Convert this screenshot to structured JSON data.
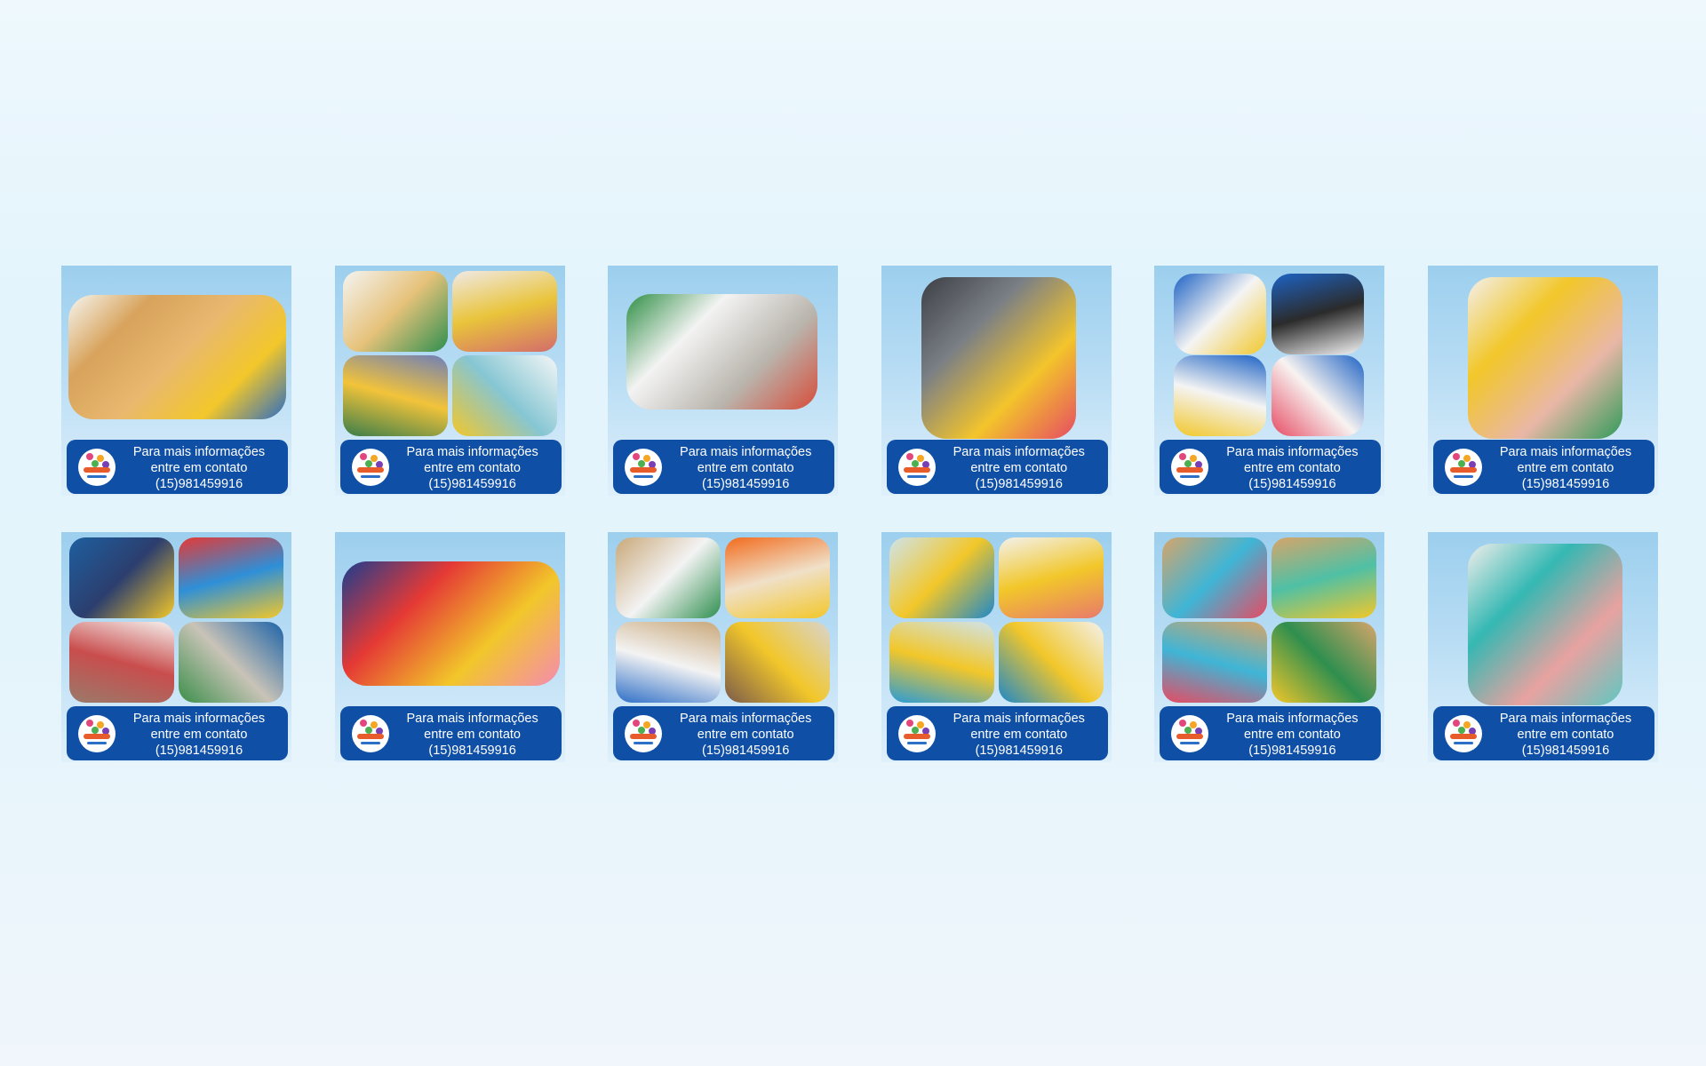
{
  "gallery": {
    "cards": [
      {
        "layout": "single-wide",
        "photo_icons": [
          "photo-icon"
        ],
        "banner": {
          "line1": "Para mais informações",
          "line2": "entre em contato",
          "phone": "(15)981459916"
        },
        "palette": [
          [
            "#f6f6f0",
            "#d8a35c",
            "#e9b86f",
            "#f2c72a",
            "#2d6cc2"
          ]
        ]
      },
      {
        "layout": "quad",
        "photo_icons": [
          "photo-icon",
          "photo-icon",
          "photo-icon",
          "photo-icon"
        ],
        "banner": {
          "line1": "Para mais informações",
          "line2": "entre em contato",
          "phone": "(15)981459916"
        },
        "palette": [
          [
            "#f4f4f2",
            "#e6c27a",
            "#2f8f4f"
          ],
          [
            "#f0e9e6",
            "#e9c43b",
            "#d46c6c"
          ],
          [
            "#6f7fb8",
            "#f2c33a",
            "#3a7d4a"
          ],
          [
            "#f4f6f7",
            "#86c6d3",
            "#f2c72a"
          ]
        ]
      },
      {
        "layout": "single-wide-short",
        "photo_icons": [
          "photo-icon"
        ],
        "banner": {
          "line1": "Para mais informações",
          "line2": "entre em contato",
          "phone": "(15)981459916"
        },
        "palette": [
          [
            "#2f8f45",
            "#f3f3f3",
            "#b9b5ad",
            "#d64d3a"
          ]
        ]
      },
      {
        "layout": "single-tall",
        "photo_icons": [
          "photo-icon"
        ],
        "banner": {
          "line1": "Para mais informações",
          "line2": "entre em contato",
          "phone": "(15)981459916"
        },
        "palette": [
          [
            "#3d3f45",
            "#7a7f86",
            "#f3c42b",
            "#e64b63"
          ]
        ]
      },
      {
        "layout": "quad-circles",
        "photo_icons": [
          "photo-icon",
          "photo-icon",
          "photo-icon",
          "photo-icon"
        ],
        "banner": {
          "line1": "Para mais informações",
          "line2": "entre em contato",
          "phone": "(15)981459916"
        },
        "palette": [
          [
            "#1e63c4",
            "#f4f4f4",
            "#f2c72a"
          ],
          [
            "#1e63c4",
            "#2b2b2b",
            "#f4f4f4"
          ],
          [
            "#1e63c4",
            "#f4f4f4",
            "#f2c72a"
          ],
          [
            "#1e63c4",
            "#f7f3f1",
            "#e64b63"
          ]
        ]
      },
      {
        "layout": "single-tall",
        "photo_icons": [
          "photo-icon"
        ],
        "banner": {
          "line1": "Para mais informações",
          "line2": "entre em contato",
          "phone": "(15)981459916"
        },
        "palette": [
          [
            "#f3efec",
            "#f2c72a",
            "#e9b7a6",
            "#2f9b5a"
          ]
        ]
      },
      {
        "layout": "quad",
        "photo_icons": [
          "photo-icon",
          "photo-icon",
          "photo-icon",
          "photo-icon"
        ],
        "banner": {
          "line1": "Para mais informações",
          "line2": "entre em contato",
          "phone": "(15)981459916"
        },
        "palette": [
          [
            "#1e5fa0",
            "#2c3e6e",
            "#f2c72a"
          ],
          [
            "#e53935",
            "#2e8fd8",
            "#f2c72a"
          ],
          [
            "#f5f1ee",
            "#c94d4d",
            "#9a7a6a"
          ],
          [
            "#1d63a8",
            "#c9c3b7",
            "#3b8f4a"
          ]
        ]
      },
      {
        "layout": "single-wide",
        "photo_icons": [
          "photo-icon"
        ],
        "banner": {
          "line1": "Para mais informações",
          "line2": "entre em contato",
          "phone": "(15)981459916"
        },
        "palette": [
          [
            "#1c3d8f",
            "#e53935",
            "#f2c72a",
            "#f58bb0"
          ]
        ]
      },
      {
        "layout": "quad",
        "photo_icons": [
          "photo-icon",
          "photo-icon",
          "photo-icon",
          "photo-icon"
        ],
        "banner": {
          "line1": "Para mais informações",
          "line2": "entre em contato",
          "phone": "(15)981459916"
        },
        "palette": [
          [
            "#c9a87a",
            "#f3f3f3",
            "#2f8f4f"
          ],
          [
            "#f26b1d",
            "#f0e0c8",
            "#f2c72a"
          ],
          [
            "#c9a87a",
            "#f3f3f3",
            "#2f6fc7"
          ],
          [
            "#d8d4cf",
            "#f2c72a",
            "#7b5b4a"
          ]
        ]
      },
      {
        "layout": "quad",
        "photo_icons": [
          "photo-icon",
          "photo-icon",
          "photo-icon",
          "photo-icon"
        ],
        "banner": {
          "line1": "Para mais informações",
          "line2": "entre em contato",
          "phone": "(15)981459916"
        },
        "palette": [
          [
            "#cfe3ea",
            "#f2c72a",
            "#1e88c8"
          ],
          [
            "#f3f1ec",
            "#f2c72a",
            "#e87a6b"
          ],
          [
            "#cfe3ea",
            "#f2c72a",
            "#2a9bd6"
          ],
          [
            "#f3f1ec",
            "#f2c72a",
            "#1e88c8"
          ]
        ]
      },
      {
        "layout": "quad",
        "photo_icons": [
          "photo-icon",
          "photo-icon",
          "photo-icon",
          "photo-icon"
        ],
        "banner": {
          "line1": "Para mais informações",
          "line2": "entre em contato",
          "phone": "(15)981459916"
        },
        "palette": [
          [
            "#d6a56a",
            "#3fb5d6",
            "#e64b63"
          ],
          [
            "#d6a56a",
            "#4fc0a5",
            "#f2c72a"
          ],
          [
            "#d6a56a",
            "#3fb5d6",
            "#e64b63"
          ],
          [
            "#d6a56a",
            "#2f8f4f",
            "#f2c72a"
          ]
        ]
      },
      {
        "layout": "single-tall",
        "photo_icons": [
          "photo-icon"
        ],
        "banner": {
          "line1": "Para mais informações",
          "line2": "entre em contato",
          "phone": "(15)981459916"
        },
        "palette": [
          [
            "#f1eeeb",
            "#35b8b3",
            "#e8a2a0",
            "#5fc7c2"
          ]
        ]
      }
    ]
  }
}
